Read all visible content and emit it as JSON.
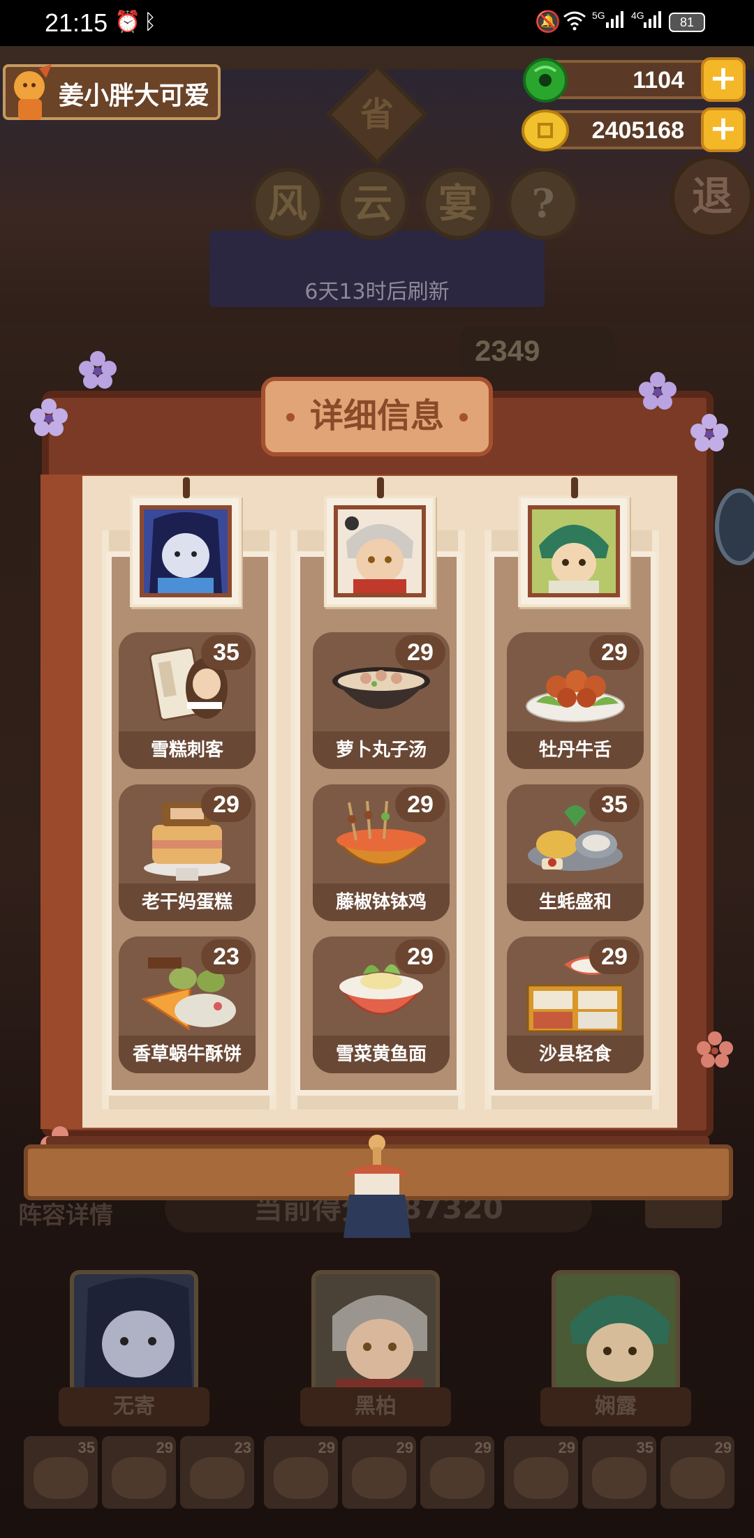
{
  "status_bar": {
    "time": "21:15",
    "battery": "81",
    "net1": "5G",
    "net2": "4G"
  },
  "player": {
    "name": "姜小胖大可爱"
  },
  "currencies": [
    {
      "name": "jade",
      "value": "1104",
      "color": "#2aa52e"
    },
    {
      "name": "coin",
      "value": "2405168",
      "color": "#f2c12e"
    }
  ],
  "header": {
    "province_char": "省",
    "title_chars": [
      "风",
      "云",
      "宴"
    ],
    "help": "?",
    "exit": "退",
    "refresh": "6天13时后刷新",
    "score_partial": "2349"
  },
  "modal": {
    "title": "详细信息",
    "columns": [
      {
        "character_icon": "char-wuji-portrait",
        "dishes": [
          {
            "name": "雪糕刺客",
            "count": "35",
            "icon": "ice-cream-assassin"
          },
          {
            "name": "老干妈蛋糕",
            "count": "29",
            "icon": "laoganma-cake"
          },
          {
            "name": "香草蜗牛酥饼",
            "count": "23",
            "icon": "vanilla-snail-pie"
          }
        ]
      },
      {
        "character_icon": "char-heibai-portrait",
        "dishes": [
          {
            "name": "萝卜丸子汤",
            "count": "29",
            "icon": "radish-ball-soup"
          },
          {
            "name": "藤椒钵钵鸡",
            "count": "29",
            "icon": "pepper-bobo-chicken"
          },
          {
            "name": "雪菜黄鱼面",
            "count": "29",
            "icon": "yellowfish-noodle"
          }
        ]
      },
      {
        "character_icon": "char-xianlu-portrait",
        "dishes": [
          {
            "name": "牡丹牛舌",
            "count": "29",
            "icon": "peony-ox-tongue"
          },
          {
            "name": "生蚝盛和",
            "count": "35",
            "icon": "oyster-platter"
          },
          {
            "name": "沙县轻食",
            "count": "29",
            "icon": "shaxian-snacks"
          }
        ]
      }
    ]
  },
  "lineup": {
    "label": "阵容详情",
    "score_text": "当前得分",
    "score_value": "287320",
    "characters": [
      "无寄",
      "黑柏",
      "娴露"
    ],
    "mini_counts": [
      "35",
      "29",
      "23",
      "29",
      "29",
      "29",
      "29",
      "35",
      "29"
    ]
  },
  "colors": {
    "wood_dark": "#5a2818",
    "paper": "#efdcc2",
    "dish_tile": "#7d5a46",
    "title_plate": "#e0a476"
  }
}
